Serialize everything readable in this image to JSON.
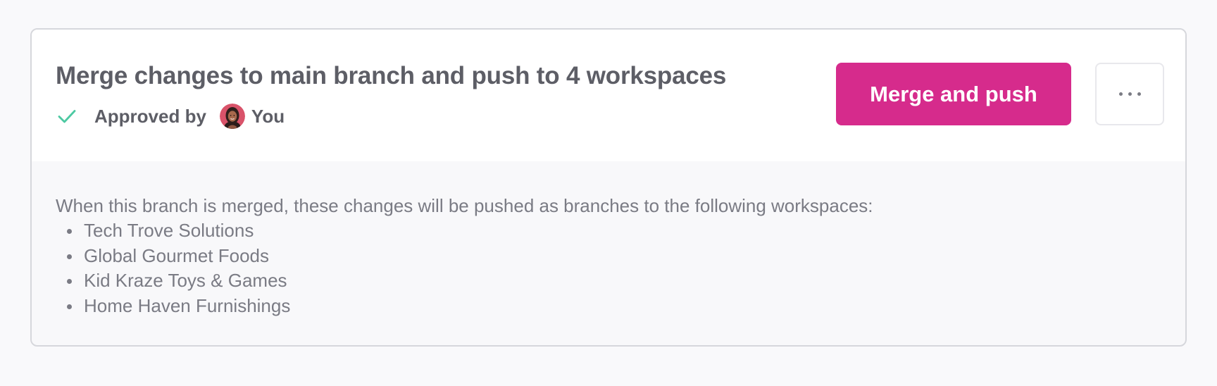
{
  "merge_card": {
    "title": "Merge changes to main branch and push to 4 workspaces",
    "approval": {
      "label": "Approved by",
      "approver": "You"
    },
    "primary_action_label": "Merge and push",
    "more_actions_icon": "more-horizontal-icon",
    "description": "When this branch is merged, these changes will be pushed as branches to the following workspaces:",
    "workspaces": [
      "Tech Trove Solutions",
      "Global Gourmet Foods",
      "Kid Kraze Toys & Games",
      "Home Haven Furnishings"
    ]
  },
  "colors": {
    "page_background": "#f9f9fb",
    "card_border": "#d6d7dc",
    "primary_button": "#d62b8c",
    "approved_check": "#4cc9a2",
    "title_text": "#5d5e66",
    "body_text": "#7a7b84"
  }
}
